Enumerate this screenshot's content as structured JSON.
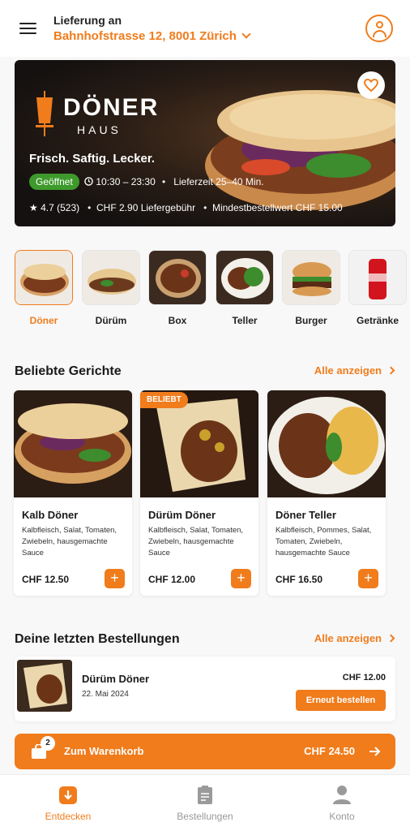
{
  "header": {
    "delivery_label": "Lieferung an",
    "address": "Bahnhofstrasse 12, 8001 Zürich",
    "menu_icon": "hamburger-menu-icon",
    "profile_icon": "user-icon"
  },
  "hero": {
    "brand_name": "DÖNER",
    "brand_sub": "HAUS",
    "tagline": "Frisch. Saftig. Lecker.",
    "status": "Geöffnet",
    "hours": "10:30 – 23:30",
    "delivery_time": "Lieferzeit 25–40 Min.",
    "rating": "4.7 (523)",
    "delivery_fee": "CHF 2.90 Liefergebühr",
    "min_order": "Mindestbestellwert CHF 15.00"
  },
  "categories": [
    {
      "label": "Döner",
      "active": true
    },
    {
      "label": "Dürüm",
      "active": false
    },
    {
      "label": "Box",
      "active": false
    },
    {
      "label": "Teller",
      "active": false
    },
    {
      "label": "Burger",
      "active": false
    },
    {
      "label": "Getränke",
      "active": false
    }
  ],
  "popular": {
    "title": "Beliebte Gerichte",
    "see_all": "Alle anzeigen",
    "items": [
      {
        "name": "Kalb Döner",
        "desc": "Kalbfleisch, Salat, Tomaten, Zwiebeln, hausgemachte Sauce",
        "price": "CHF 12.50",
        "badge": ""
      },
      {
        "name": "Dürüm Döner",
        "desc": "Kalbfleisch, Salat, Tomaten, Zwiebeln, hausgemachte Sauce",
        "price": "CHF 12.00",
        "badge": "BELIEBT"
      },
      {
        "name": "Döner Teller",
        "desc": "Kalbfleisch, Pommes, Salat, Tomaten, Zwiebeln, hausgemachte Sauce",
        "price": "CHF 16.50",
        "badge": ""
      }
    ]
  },
  "recent": {
    "title": "Deine letzten Bestellungen",
    "see_all": "Alle anzeigen",
    "order": {
      "name": "Dürüm Döner",
      "date": "22. Mai 2024",
      "price": "CHF 12.00",
      "button": "Erneut bestellen"
    }
  },
  "cart": {
    "count": "2",
    "label": "Zum Warenkorb",
    "total": "CHF 24.50"
  },
  "nav": [
    {
      "label": "Entdecken",
      "icon": "discover-icon",
      "active": true
    },
    {
      "label": "Bestellungen",
      "icon": "clipboard-icon",
      "active": false
    },
    {
      "label": "Konto",
      "icon": "user-icon",
      "active": false
    }
  ],
  "colors": {
    "accent": "#f07c1c",
    "open_green": "#3e9a2c"
  }
}
